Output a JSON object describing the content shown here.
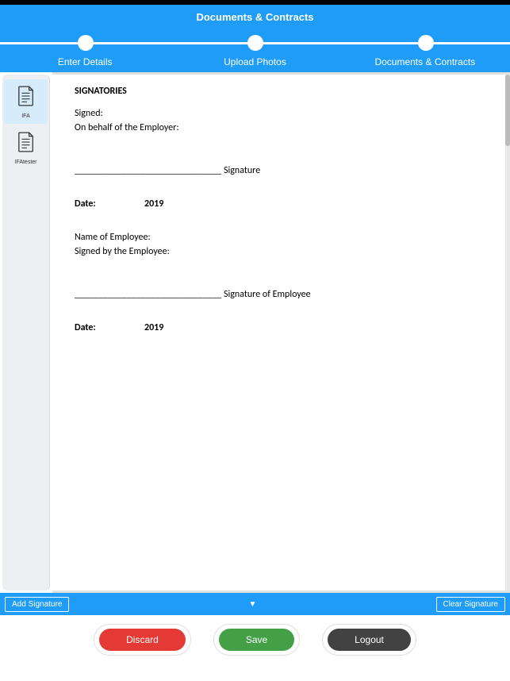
{
  "header": {
    "title": "Documents & Contracts"
  },
  "stepper": {
    "step1": "Enter Details",
    "step2": "Upload Photos",
    "step3": "Documents & Contracts"
  },
  "sidebar": {
    "items": [
      {
        "label": "IFA",
        "active": true
      },
      {
        "label": "IFAtester",
        "active": false
      }
    ]
  },
  "document": {
    "signatories_heading": "SIGNATORIES",
    "signed_label": "Signed:",
    "employer_behalf": "On behalf of the Employer:",
    "signature_line": "_______________________________",
    "signature_label": "Signature",
    "date_label": "Date:",
    "year1": "2019",
    "employee_name_label": "Name of Employee:",
    "employee_signed_label": "Signed by the Employee:",
    "employee_signature_label": "Signature of Employee",
    "year2": "2019"
  },
  "bluebar": {
    "add_signature": "Add Signature",
    "dropdown_caret": "▼",
    "clear_signature": "Clear Signature"
  },
  "footer": {
    "discard": "Discard",
    "save": "Save",
    "logout": "Logout"
  }
}
